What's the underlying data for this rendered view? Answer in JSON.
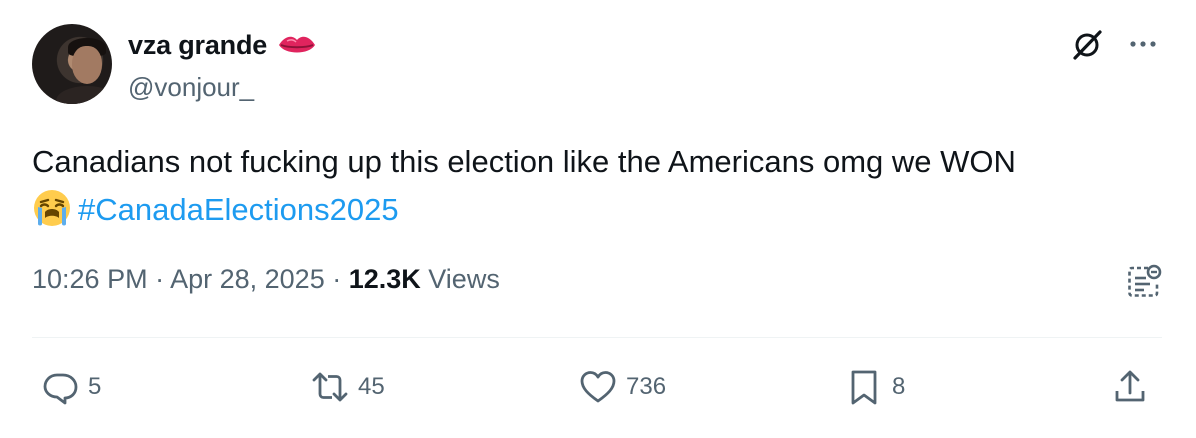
{
  "author": {
    "display_name": "vza grande",
    "handle": "@vonjour_",
    "name_emoji_icon": "lips-icon"
  },
  "tweet": {
    "text_line1": "Canadians not fucking up this election like the Americans omg we WON",
    "emoji_icon": "loudly-crying-face-icon",
    "hashtag": "#CanadaElections2025"
  },
  "meta": {
    "time": "10:26 PM",
    "separator1": " · ",
    "date": "Apr 28, 2025",
    "separator2": " · ",
    "views_count": "12.3K",
    "views_label": " Views"
  },
  "actions": {
    "replies": "5",
    "reposts": "45",
    "likes": "736",
    "bookmarks": "8"
  },
  "colors": {
    "text": "#0f1419",
    "secondary": "#536471",
    "link": "#1d9bf0",
    "divider": "#eff3f4"
  }
}
